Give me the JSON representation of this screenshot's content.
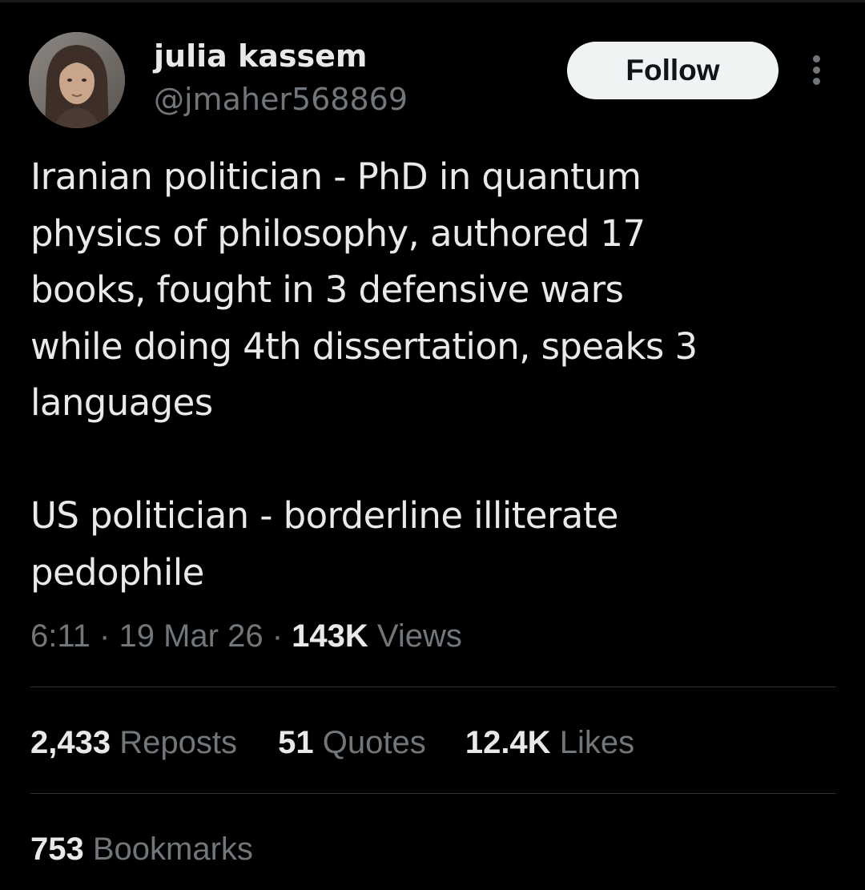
{
  "author": {
    "display_name": "julia kassem",
    "handle": "@jmaher568869"
  },
  "follow_button": {
    "label": "Follow"
  },
  "tweet": {
    "lines_part1": [
      "Iranian politician - PhD in quantum",
      "physics of philosophy, authored 17",
      "books, fought in 3 defensive wars",
      "while doing 4th dissertation, speaks 3",
      "languages"
    ],
    "lines_part2": [
      "US politician - borderline illiterate",
      "pedophile"
    ]
  },
  "meta": {
    "time": "6:11",
    "separator": "·",
    "date": "19 Mar 26",
    "views_count": "143K",
    "views_label": "Views"
  },
  "stats": {
    "reposts_count": "2,433",
    "reposts_label": "Reposts",
    "quotes_count": "51",
    "quotes_label": "Quotes",
    "likes_count": "12.4K",
    "likes_label": "Likes",
    "bookmarks_count": "753",
    "bookmarks_label": "Bookmarks"
  },
  "colors": {
    "background": "#000000",
    "primary_text": "#e7e9ea",
    "secondary_text": "#71767b",
    "divider": "#2f3336",
    "follow_button_bg": "#eff3f4",
    "follow_button_text": "#0f1419"
  },
  "icons": {
    "more": "more-options-icon"
  }
}
